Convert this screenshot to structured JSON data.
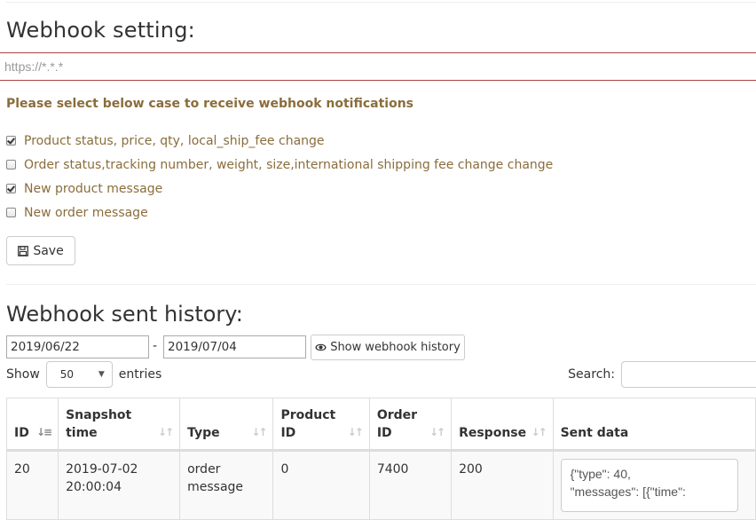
{
  "settings": {
    "title": "Webhook setting:",
    "url_placeholder": "https://*.*.*",
    "url_value": "",
    "instruction": "Please select below case to receive webhook notifications",
    "options": [
      {
        "label": "Product status, price, qty, local_ship_fee change",
        "checked": true
      },
      {
        "label": "Order status,tracking number, weight, size,international shipping fee change change",
        "checked": false
      },
      {
        "label": "New product message",
        "checked": true
      },
      {
        "label": "New order message",
        "checked": false
      }
    ],
    "save_label": "Save",
    "save_icon": "floppy-disk-icon"
  },
  "history": {
    "title": "Webhook sent history:",
    "date_from": "2019/06/22",
    "date_separator": "-",
    "date_to": "2019/07/04",
    "show_button_label": "Show webhook history",
    "show_button_icon": "eye-icon",
    "length_prefix": "Show",
    "length_value": "50",
    "length_suffix": "entries",
    "search_label": "Search:",
    "search_value": "",
    "columns": [
      {
        "line1": "ID",
        "line2": "",
        "sort": "desc"
      },
      {
        "line1": "Snapshot",
        "line2": "time",
        "sort": "both"
      },
      {
        "line1": "Type",
        "line2": "",
        "sort": "both"
      },
      {
        "line1": "Product",
        "line2": "ID",
        "sort": "both"
      },
      {
        "line1": "Order",
        "line2": "ID",
        "sort": "both"
      },
      {
        "line1": "Response",
        "line2": "",
        "sort": "both"
      },
      {
        "line1": "Sent data",
        "line2": "",
        "sort": "none"
      }
    ],
    "rows": [
      {
        "id": "20",
        "snapshot_time": "2019-07-02  20:00:04",
        "type": "order message",
        "product_id": "0",
        "order_id": "7400",
        "response": "200",
        "sent_data": "{\"type\": 40,\n\"messages\": [{\"time\":"
      }
    ]
  }
}
